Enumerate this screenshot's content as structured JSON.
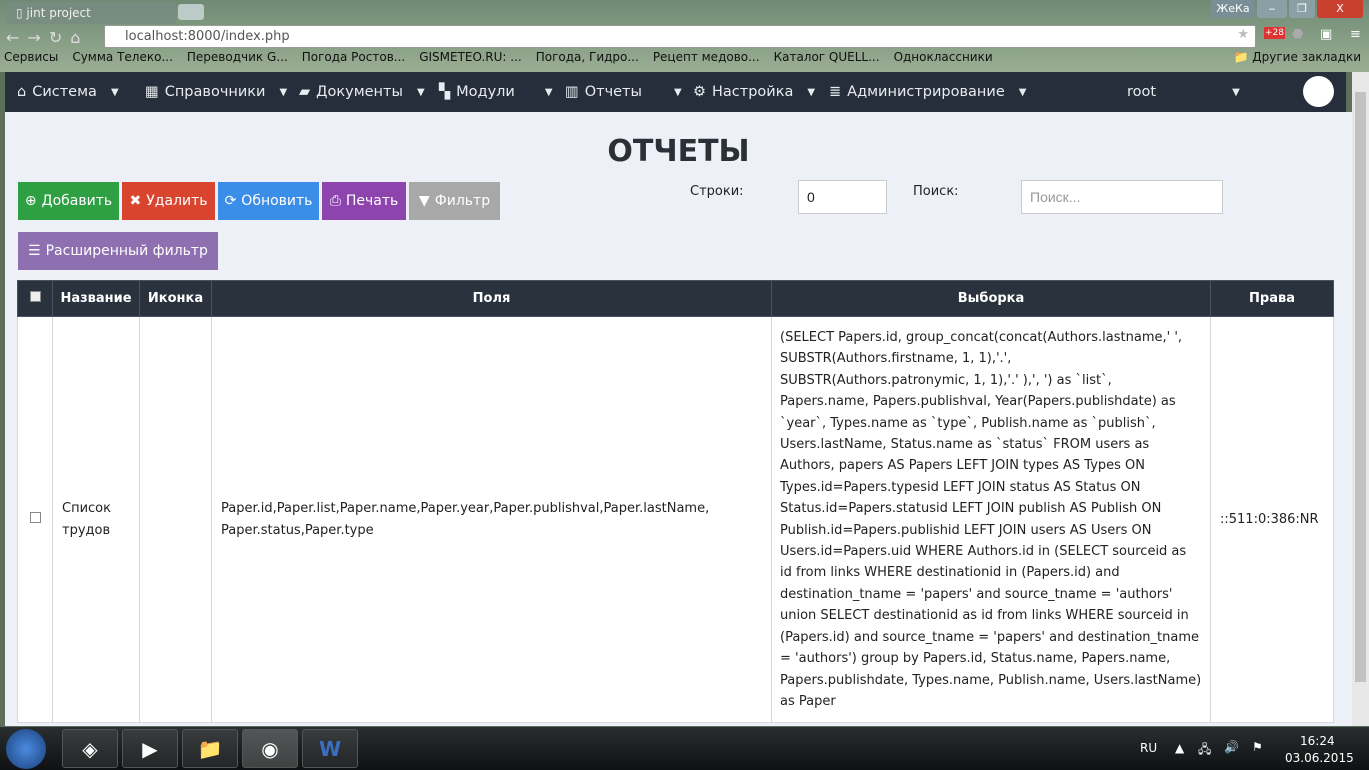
{
  "browser": {
    "tab_title": "jint project",
    "url": "localhost:8000/index.php",
    "user_badge": "ЖеКа",
    "ext_badge": "+28",
    "bookmarks": [
      "Сервисы",
      "Сумма Телеко...",
      "Переводчик G...",
      "Погода Ростов...",
      "GISMETEO.RU: ...",
      "Погода, Гидро...",
      "Рецепт медово...",
      "Каталог QUELL...",
      "Одноклассники"
    ],
    "other_bookmarks": "Другие закладки"
  },
  "navbar": {
    "items": [
      {
        "icon": "home-icon",
        "label": "Система"
      },
      {
        "icon": "table-icon",
        "label": "Справочники"
      },
      {
        "icon": "book-icon",
        "label": "Документы"
      },
      {
        "icon": "grid-icon",
        "label": "Модули"
      },
      {
        "icon": "bar-chart-icon",
        "label": "Отчеты"
      },
      {
        "icon": "gears-icon",
        "label": "Настройка"
      },
      {
        "icon": "list-icon",
        "label": "Администрирование"
      }
    ],
    "user": "root"
  },
  "page": {
    "title": "ОТЧЕТЫ",
    "buttons": {
      "add": "Добавить",
      "delete": "Удалить",
      "refresh": "Обновить",
      "print": "Печать",
      "filter": "Фильтр",
      "advanced_filter": "Расширенный фильтр"
    },
    "rows_label": "Строки:",
    "rows_value": "0",
    "search_label": "Поиск:",
    "search_placeholder": "Поиск...",
    "colors": {
      "add": "#2ea043",
      "delete": "#d9442f",
      "refresh": "#3b8ee8",
      "print": "#8e44ad",
      "filter": "#a8a8a8",
      "advanced": "#8e6fb0",
      "header": "#2a323e"
    }
  },
  "table": {
    "headers": [
      "Название",
      "Иконка",
      "Поля",
      "Выборка",
      "Права"
    ],
    "rows": [
      {
        "name": "Список трудов",
        "icon": "",
        "fields": "Paper.id,Paper.list,Paper.name,Paper.year,Paper.publishval,Paper.lastName, Paper.status,Paper.type",
        "query": "(SELECT Papers.id, group_concat(concat(Authors.lastname,' ', SUBSTR(Authors.firstname, 1, 1),'.', SUBSTR(Authors.patronymic, 1, 1),'.' ),', ') as `list`, Papers.name, Papers.publishval, Year(Papers.publishdate) as `year`, Types.name as `type`, Publish.name as `publish`, Users.lastName, Status.name as `status` FROM users as Authors, papers AS Papers LEFT JOIN types AS Types ON Types.id=Papers.typesid LEFT JOIN status AS Status ON Status.id=Papers.statusid LEFT JOIN publish AS Publish ON Publish.id=Papers.publishid LEFT JOIN users AS Users ON Users.id=Papers.uid WHERE Authors.id in (SELECT sourceid as id from links WHERE destinationid in (Papers.id) and destination_tname = 'papers' and source_tname = 'authors' union SELECT destinationid as id from links WHERE sourceid in (Papers.id) and source_tname = 'papers' and destination_tname = 'authors') group by Papers.id, Status.name, Papers.name, Papers.publishdate, Types.name, Publish.name, Users.lastName) as Paper",
        "rights": "::511:0:386:NR"
      }
    ]
  },
  "taskbar": {
    "lang": "RU",
    "time": "16:24",
    "date": "03.06.2015"
  }
}
